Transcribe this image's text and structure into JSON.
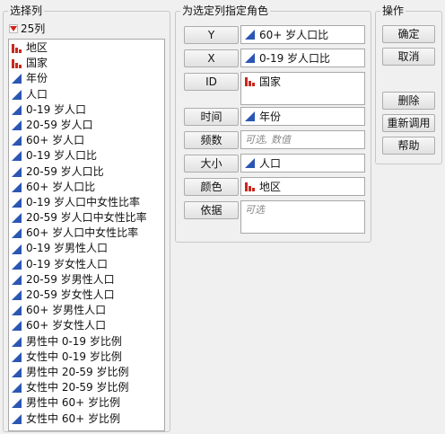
{
  "select_columns": {
    "title": "选择列",
    "count": "25列",
    "items": [
      {
        "label": "地区",
        "type": "nominal"
      },
      {
        "label": "国家",
        "type": "nominal"
      },
      {
        "label": "年份",
        "type": "continuous"
      },
      {
        "label": "人口",
        "type": "continuous"
      },
      {
        "label": "0-19 岁人口",
        "type": "continuous"
      },
      {
        "label": "20-59 岁人口",
        "type": "continuous"
      },
      {
        "label": "60+ 岁人口",
        "type": "continuous"
      },
      {
        "label": "0-19 岁人口比",
        "type": "continuous"
      },
      {
        "label": "20-59 岁人口比",
        "type": "continuous"
      },
      {
        "label": "60+ 岁人口比",
        "type": "continuous"
      },
      {
        "label": "0-19 岁人口中女性比率",
        "type": "continuous"
      },
      {
        "label": "20-59 岁人口中女性比率",
        "type": "continuous"
      },
      {
        "label": "60+ 岁人口中女性比率",
        "type": "continuous"
      },
      {
        "label": "0-19 岁男性人口",
        "type": "continuous"
      },
      {
        "label": "0-19 岁女性人口",
        "type": "continuous"
      },
      {
        "label": "20-59 岁男性人口",
        "type": "continuous"
      },
      {
        "label": "20-59 岁女性人口",
        "type": "continuous"
      },
      {
        "label": "60+ 岁男性人口",
        "type": "continuous"
      },
      {
        "label": "60+ 岁女性人口",
        "type": "continuous"
      },
      {
        "label": "男性中 0-19 岁比例",
        "type": "continuous"
      },
      {
        "label": "女性中 0-19 岁比例",
        "type": "continuous"
      },
      {
        "label": "男性中 20-59 岁比例",
        "type": "continuous"
      },
      {
        "label": "女性中 20-59 岁比例",
        "type": "continuous"
      },
      {
        "label": "男性中 60+ 岁比例",
        "type": "continuous"
      },
      {
        "label": "女性中 60+ 岁比例",
        "type": "continuous"
      }
    ]
  },
  "roles": {
    "title": "为选定列指定角色",
    "y": {
      "button": "Y",
      "value": "60+ 岁人口比",
      "type": "continuous"
    },
    "x": {
      "button": "X",
      "value": "0-19 岁人口比",
      "type": "continuous"
    },
    "id": {
      "button": "ID",
      "value": "国家",
      "type": "nominal"
    },
    "time": {
      "button": "时间",
      "value": "年份",
      "type": "continuous"
    },
    "freq": {
      "button": "频数",
      "placeholder": "可选, 数值"
    },
    "size": {
      "button": "大小",
      "value": "人口",
      "type": "continuous"
    },
    "color": {
      "button": "颜色",
      "value": "地区",
      "type": "nominal"
    },
    "by": {
      "button": "依据",
      "placeholder": "可选"
    }
  },
  "actions": {
    "title": "操作",
    "ok": "确定",
    "cancel": "取消",
    "remove": "删除",
    "recall": "重新调用",
    "help": "帮助"
  },
  "icons": {
    "continuous": "continuous-column-icon",
    "nominal": "nominal-column-icon",
    "menu": "red-triangle-menu-icon"
  },
  "colors": {
    "continuous_icon": "#2b56b3",
    "nominal_icon": "#c8281e",
    "menu_triangle": "#d0241a"
  }
}
